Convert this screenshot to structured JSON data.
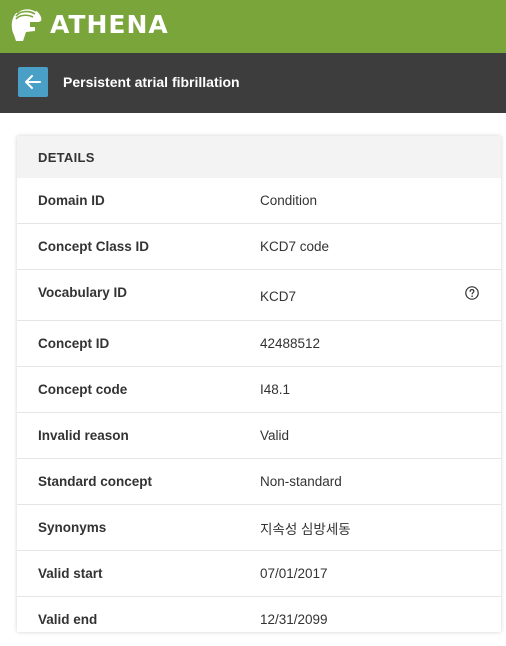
{
  "brand": {
    "name": "ATHENA"
  },
  "header": {
    "title": "Persistent atrial fibrillation"
  },
  "details": {
    "heading": "DETAILS",
    "rows": [
      {
        "label": "Domain ID",
        "value": "Condition"
      },
      {
        "label": "Concept Class ID",
        "value": "KCD7 code"
      },
      {
        "label": "Vocabulary ID",
        "value": "KCD7"
      },
      {
        "label": "Concept ID",
        "value": "42488512"
      },
      {
        "label": "Concept code",
        "value": "I48.1"
      },
      {
        "label": "Invalid reason",
        "value": "Valid"
      },
      {
        "label": "Standard concept",
        "value": "Non-standard"
      },
      {
        "label": "Synonyms",
        "value": "지속성 심방세동"
      },
      {
        "label": "Valid start",
        "value": "07/01/2017"
      },
      {
        "label": "Valid end",
        "value": "12/31/2099"
      }
    ]
  },
  "icons": {
    "logo": "helmet-icon",
    "back": "arrow-left-icon",
    "help": "question-circle-icon"
  },
  "colors": {
    "brand_bar": "#7aa53a",
    "sub_bar": "#3d3d3d",
    "back_button": "#4a9fc7"
  }
}
